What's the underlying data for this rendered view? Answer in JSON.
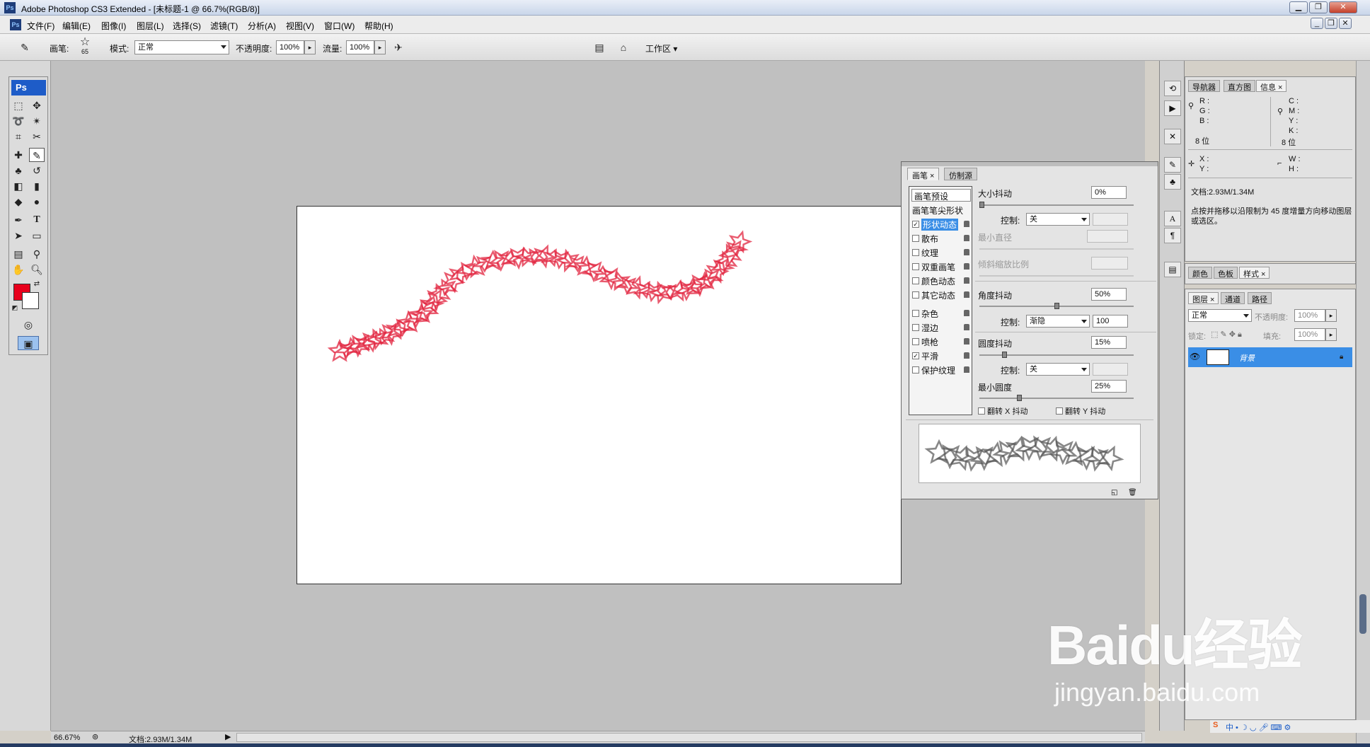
{
  "window": {
    "title": "Adobe Photoshop CS3 Extended - [未标题-1 @ 66.7%(RGB/8)]",
    "app_icon": "Ps"
  },
  "menu": [
    "文件(F)",
    "编辑(E)",
    "图像(I)",
    "图层(L)",
    "选择(S)",
    "滤镜(T)",
    "分析(A)",
    "视图(V)",
    "窗口(W)",
    "帮助(H)"
  ],
  "options": {
    "brush_label": "画笔:",
    "brush_size": "65",
    "mode_label": "模式:",
    "mode_value": "正常",
    "opacity_label": "不透明度:",
    "opacity_value": "100%",
    "flow_label": "流量:",
    "flow_value": "100%",
    "workspace_label": "工作区"
  },
  "toolbox": {
    "logo": "Ps"
  },
  "brush_panel": {
    "tabs": [
      "画笔",
      "仿制源"
    ],
    "list_header": "画笔预设",
    "tip_shape": "画笔笔尖形状",
    "items": [
      {
        "label": "形状动态",
        "checked": true,
        "selected": true
      },
      {
        "label": "散布",
        "checked": false
      },
      {
        "label": "纹理",
        "checked": false
      },
      {
        "label": "双重画笔",
        "checked": false
      },
      {
        "label": "颜色动态",
        "checked": false
      },
      {
        "label": "其它动态",
        "checked": false
      },
      {
        "label": "杂色",
        "checked": false
      },
      {
        "label": "湿边",
        "checked": false
      },
      {
        "label": "喷枪",
        "checked": false
      },
      {
        "label": "平滑",
        "checked": true
      },
      {
        "label": "保护纹理",
        "checked": false
      }
    ],
    "size_jitter_label": "大小抖动",
    "size_jitter_value": "0%",
    "control_label": "控制:",
    "control1_value": "关",
    "min_diameter_label": "最小直径",
    "tilt_scale_label": "倾斜缩放比例",
    "angle_jitter_label": "角度抖动",
    "angle_jitter_value": "50%",
    "control2_value": "渐隐",
    "control2_steps": "100",
    "roundness_jitter_label": "圆度抖动",
    "roundness_jitter_value": "15%",
    "control3_value": "关",
    "min_roundness_label": "最小圆度",
    "min_roundness_value": "25%",
    "flip_x_label": "翻转 X 抖动",
    "flip_y_label": "翻转 Y 抖动"
  },
  "info_panel": {
    "tabs": [
      "导航器",
      "直方图",
      "信息"
    ],
    "rgb_labels": [
      "R :",
      "G :",
      "B :"
    ],
    "cmyk_labels": [
      "C :",
      "M :",
      "Y :",
      "K :"
    ],
    "bits_left": "8 位",
    "bits_right": "8 位",
    "xy_labels": [
      "X :",
      "Y :"
    ],
    "wh_labels": [
      "W :",
      "H :"
    ],
    "doc_size": "文档:2.93M/1.34M",
    "hint": "点按并拖移以沿限制为 45 度增量方向移动图层或选区。"
  },
  "color_panel": {
    "tabs": [
      "颜色",
      "色板",
      "样式"
    ]
  },
  "layers_panel": {
    "tabs": [
      "图层",
      "通道",
      "路径"
    ],
    "blend_mode": "正常",
    "opacity_label": "不透明度:",
    "opacity_value": "100%",
    "lock_label": "锁定:",
    "fill_label": "填充:",
    "fill_value": "100%",
    "layer_name": "背景"
  },
  "status": {
    "zoom": "66.67%",
    "doc": "文档:2.93M/1.34M"
  },
  "watermark": {
    "brand": "Baidu经验",
    "url": "jingyan.baidu.com"
  },
  "colors": {
    "foreground": "#e8001c",
    "background": "#ffffff",
    "stroke": "#e2243f",
    "selection": "#3a8ee6"
  }
}
